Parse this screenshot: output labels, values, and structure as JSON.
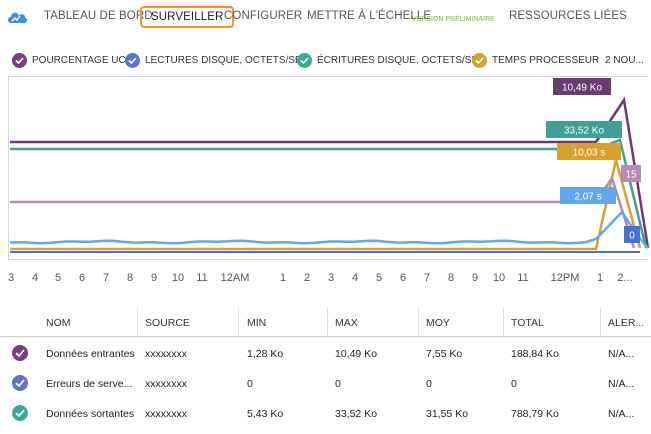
{
  "nav": {
    "tabs": [
      {
        "label": "TABLEAU DE BORD",
        "active": false
      },
      {
        "label": "SURVEILLER",
        "active": true
      },
      {
        "label": "CONFIGURER",
        "active": false
      },
      {
        "label": "METTRE À L'ÉCHELLE",
        "active": false
      },
      {
        "label": "RESSOURCES LIÉES",
        "active": false
      }
    ],
    "preview_badge": "VERSION PRÉLIMINAIRE"
  },
  "legend": {
    "items": [
      {
        "label": "POURCENTAGE UC",
        "color": "#7a3f7e"
      },
      {
        "label": "LECTURES DISQUE, OCTETS/SEC",
        "color": "#5b73c9"
      },
      {
        "label": "ÉCRITURES DISQUE, OCTETS/SEC",
        "color": "#3fa89b"
      },
      {
        "label": "TEMPS PROCESSEUR",
        "color": "#d6a12e"
      }
    ],
    "more": "2 NOU..."
  },
  "chart_data": {
    "type": "line",
    "x_ticks": [
      "3",
      "4",
      "5",
      "6",
      "7",
      "8",
      "9",
      "10",
      "11",
      "12AM",
      "1",
      "2",
      "3",
      "4",
      "5",
      "6",
      "7",
      "8",
      "9",
      "10",
      "11",
      "12PM",
      "1",
      "2..."
    ],
    "flags": [
      {
        "label": "10,49 Ko",
        "color": "#6a3a72"
      },
      {
        "label": "33,52 Ko",
        "color": "#3fa09a"
      },
      {
        "label": "10,03 s",
        "color": "#d6a12e"
      },
      {
        "label": "15",
        "color": "#b48bb5"
      },
      {
        "label": "2,07 s",
        "color": "#62a8ee"
      },
      {
        "label": "0",
        "color": "#4a6ed1"
      }
    ],
    "series_colors": {
      "purple": "#6a3a72",
      "teal": "#3fa09a",
      "gold": "#d6a12e",
      "lavender": "#b48bb5",
      "lightblue": "#62a8ee",
      "blue": "#4a6ed1"
    }
  },
  "table": {
    "headers": [
      "NOM",
      "SOURCE",
      "MIN",
      "MAX",
      "MOY",
      "TOTAL",
      "ALER..."
    ],
    "rows": [
      {
        "name": "Données entrantes",
        "source": "xxxxxxxx",
        "min": "1,28 Ko",
        "max": "10,49 Ko",
        "avg": "7,55 Ko",
        "total": "188,84 Ko",
        "alert": "N/A...",
        "color": "#7a3f7e"
      },
      {
        "name": "Erreurs de serve...",
        "source": "xxxxxxxx",
        "min": "0",
        "max": "0",
        "avg": "0",
        "total": "0",
        "alert": "N/A...",
        "color": "#5b73c9"
      },
      {
        "name": "Données sortantes",
        "source": "xxxxxxxx",
        "min": "5,43 Ko",
        "max": "33,52 Ko",
        "avg": "31,55 Ko",
        "total": "788,79 Ko",
        "alert": "N/A...",
        "color": "#3fa89b"
      }
    ]
  }
}
